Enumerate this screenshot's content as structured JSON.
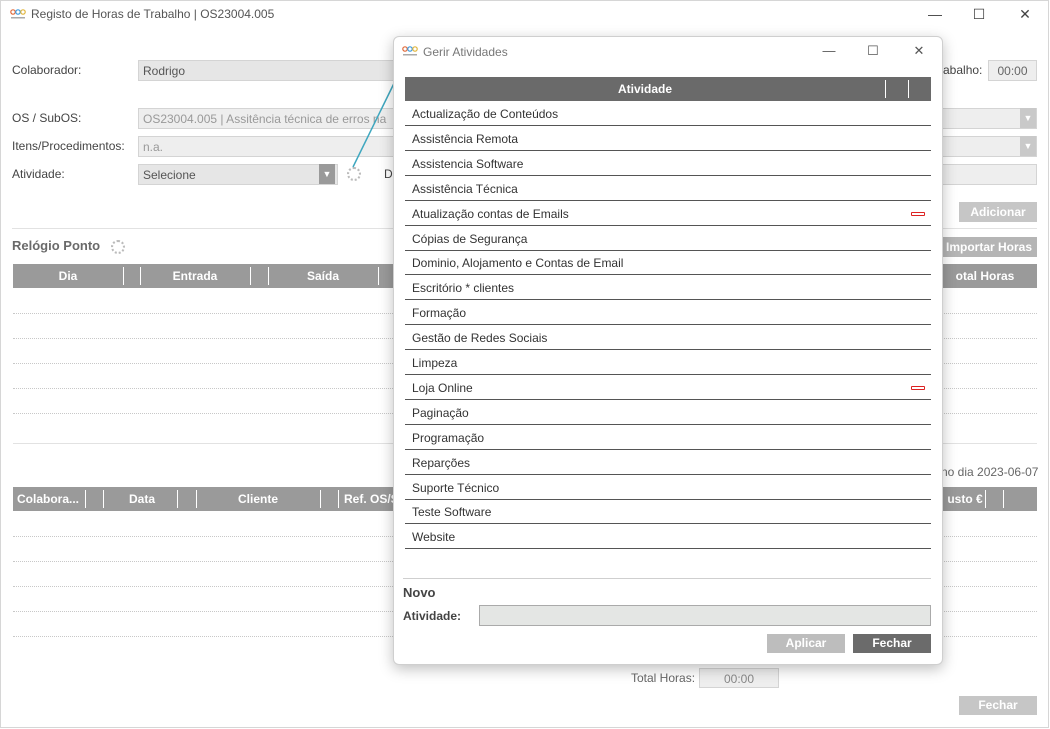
{
  "window": {
    "title": "Registo de Horas de Trabalho | OS23004.005",
    "minimize_glyph": "—",
    "maximize_glyph": "☐",
    "close_glyph": "✕"
  },
  "form": {
    "colaborador_label": "Colaborador:",
    "colaborador_value": "Rodrigo",
    "horas_label_partial": "abalho:",
    "horas_value": "00:00",
    "os_label": "OS / SubOS:",
    "os_value": "OS23004.005 | Assitência técnica de erros na",
    "itens_label": "Itens/Procedimentos:",
    "itens_value": "n.a.",
    "atividade_label": "Atividade:",
    "atividade_value": "Selecione",
    "d_label_partial": "D",
    "adicionar_button": "Adicionar"
  },
  "relogio": {
    "title": "Relógio Ponto",
    "importar_button": "Importar Horas",
    "columns": [
      "Dia",
      "Entrada",
      "Saída"
    ],
    "total_horas_partial": "otal Horas"
  },
  "registos": {
    "date_partial": "no dia 2023-06-07",
    "columns": [
      "Colabora...",
      "Data",
      "Cliente",
      "Ref. OS/S"
    ],
    "custo_partial": "usto €",
    "total_horas_label": "Total Horas:",
    "total_horas_value": "00:00",
    "fechar_button": "Fechar"
  },
  "modal": {
    "title": "Gerir Atividades",
    "column_header": "Atividade",
    "activities": [
      {
        "name": "Actualização de Conteúdos",
        "removable": false
      },
      {
        "name": "Assistência Remota",
        "removable": false
      },
      {
        "name": "Assistencia Software",
        "removable": false
      },
      {
        "name": "Assistência Técnica",
        "removable": false
      },
      {
        "name": "Atualização contas de Emails",
        "removable": true
      },
      {
        "name": "Cópias de Segurança",
        "removable": false
      },
      {
        "name": "Dominio, Alojamento e Contas de Email",
        "removable": false
      },
      {
        "name": "Escritório * clientes",
        "removable": false
      },
      {
        "name": "Formação",
        "removable": false
      },
      {
        "name": "Gestão de Redes Sociais",
        "removable": false
      },
      {
        "name": "Limpeza",
        "removable": false
      },
      {
        "name": "Loja Online",
        "removable": true
      },
      {
        "name": "Paginação",
        "removable": false
      },
      {
        "name": "Programação",
        "removable": false
      },
      {
        "name": "Reparções",
        "removable": false
      },
      {
        "name": "Suporte Técnico",
        "removable": false
      },
      {
        "name": "Teste Software",
        "removable": false
      },
      {
        "name": "Website",
        "removable": false
      }
    ],
    "novo_title": "Novo",
    "atividade_label": "Atividade:",
    "atividade_value": "",
    "aplicar_button": "Aplicar",
    "fechar_button": "Fechar"
  },
  "colors": {
    "header_gray": "#9a9a9a",
    "modal_header": "#6a6a6a",
    "remove_red": "#dd2222",
    "arrow_teal": "#3fa7bf"
  }
}
